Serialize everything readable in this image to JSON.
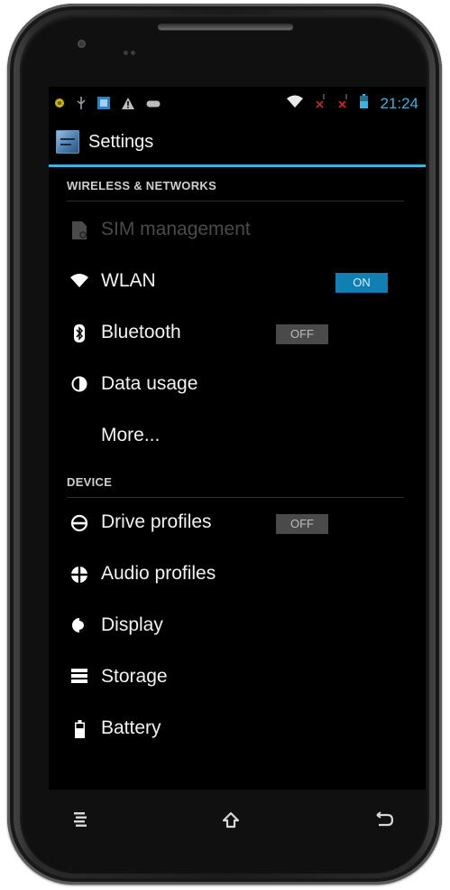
{
  "status_bar": {
    "left_icons": [
      "headset-icon",
      "usb-icon",
      "sim-toolkit-icon",
      "warning-icon",
      "voicemail-icon"
    ],
    "right_icons": [
      "wifi-icon",
      "signal-no-service-icon",
      "signal-no-service-2-icon",
      "battery-icon"
    ],
    "clock": "21:24",
    "accent_color": "#33b5e5"
  },
  "action_bar": {
    "title": "Settings",
    "icon": "settings-app-icon"
  },
  "sections": {
    "wireless": {
      "header": "WIRELESS & NETWORKS",
      "items": [
        {
          "label": "SIM management",
          "icon": "sim-card-icon",
          "enabled": false
        },
        {
          "label": "WLAN",
          "icon": "wifi-icon",
          "toggle": "ON"
        },
        {
          "label": "Bluetooth",
          "icon": "bluetooth-icon",
          "toggle": "OFF"
        },
        {
          "label": "Data usage",
          "icon": "data-usage-icon"
        },
        {
          "label": "More...",
          "icon": ""
        }
      ]
    },
    "device": {
      "header": "DEVICE",
      "items": [
        {
          "label": "Drive profiles",
          "icon": "drive-profiles-icon",
          "toggle": "OFF"
        },
        {
          "label": "Audio profiles",
          "icon": "audio-profiles-icon"
        },
        {
          "label": "Display",
          "icon": "display-icon"
        },
        {
          "label": "Storage",
          "icon": "storage-icon"
        },
        {
          "label": "Battery",
          "icon": "battery-icon"
        }
      ]
    }
  },
  "nav_bar": {
    "buttons": [
      "menu-icon",
      "home-icon",
      "back-icon"
    ]
  }
}
